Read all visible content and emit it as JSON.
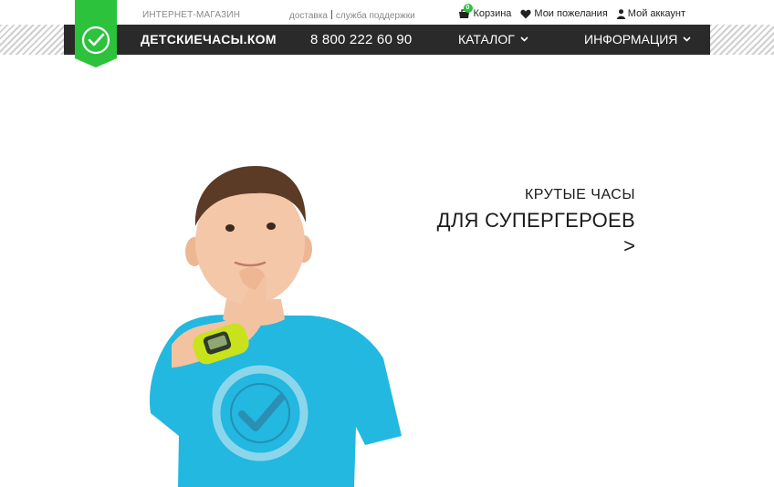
{
  "header": {
    "shop_label": "ИНТЕРНЕТ-МАГАЗИН",
    "links": [
      "доставка",
      "служба поддержки"
    ],
    "cart_label": "Корзина",
    "cart_count": "0",
    "wishlist_label": "Мои пожелания",
    "account_label": "Мой аккаунт"
  },
  "nav": {
    "brand": "ДЕТСКИЕЧАСЫ.КОМ",
    "phone": "8 800 222 60 90",
    "catalog_label": "КАТАЛОГ",
    "info_label": "ИНФОРМАЦИЯ"
  },
  "hero": {
    "line1": "КРУТЫЕ ЧАСЫ",
    "line2": "ДЛЯ СУПЕРГЕРОЕВ",
    "arrow": ">"
  },
  "colors": {
    "accent": "#2cc23c",
    "nav_bg": "#2a2a2a",
    "shirt": "#22b8e0",
    "watch": "#c8e21c"
  },
  "icons": [
    "checkmark-logo-icon",
    "cart-icon",
    "heart-icon",
    "user-icon",
    "chevron-down-icon"
  ]
}
